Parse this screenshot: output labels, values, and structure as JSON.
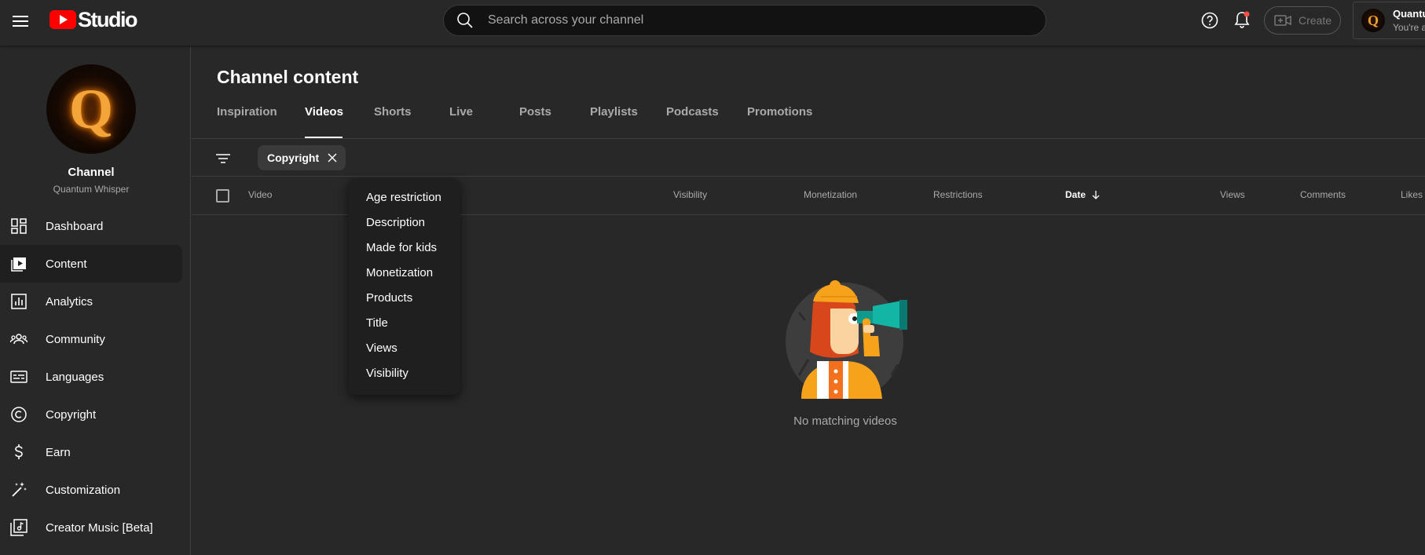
{
  "header": {
    "logo_text": "Studio",
    "search_placeholder": "Search across your channel",
    "create_label": "Create",
    "account_name": "Quantu",
    "account_sub": "You're a",
    "account_initial": "Q"
  },
  "channel": {
    "avatar_letter": "Q",
    "title": "Channel",
    "name": "Quantum Whisper"
  },
  "sidebar": {
    "items": [
      {
        "label": "Dashboard",
        "icon": "dashboard-icon"
      },
      {
        "label": "Content",
        "icon": "content-icon",
        "active": true
      },
      {
        "label": "Analytics",
        "icon": "analytics-icon"
      },
      {
        "label": "Community",
        "icon": "community-icon"
      },
      {
        "label": "Languages",
        "icon": "languages-icon"
      },
      {
        "label": "Copyright",
        "icon": "copyright-icon"
      },
      {
        "label": "Earn",
        "icon": "earn-icon"
      },
      {
        "label": "Customization",
        "icon": "customization-icon"
      },
      {
        "label": "Creator Music [Beta]",
        "icon": "music-icon"
      }
    ]
  },
  "main": {
    "title": "Channel content",
    "tabs": [
      {
        "label": "Inspiration"
      },
      {
        "label": "Videos",
        "active": true
      },
      {
        "label": "Shorts"
      },
      {
        "label": "Live"
      },
      {
        "label": "Posts"
      },
      {
        "label": "Playlists"
      },
      {
        "label": "Podcasts"
      },
      {
        "label": "Promotions"
      }
    ],
    "filter_chip": "Copyright",
    "columns": {
      "video": "Video",
      "visibility": "Visibility",
      "monetization": "Monetization",
      "restrictions": "Restrictions",
      "date": "Date",
      "views": "Views",
      "comments": "Comments",
      "likes": "Likes"
    },
    "empty_message": "No matching videos"
  },
  "dropdown": {
    "items": [
      "Age restriction",
      "Description",
      "Made for kids",
      "Monetization",
      "Products",
      "Title",
      "Views",
      "Visibility"
    ]
  },
  "colors": {
    "background": "#282828",
    "brand_red": "#ff0000",
    "notification_dot": "#ff4e45"
  }
}
